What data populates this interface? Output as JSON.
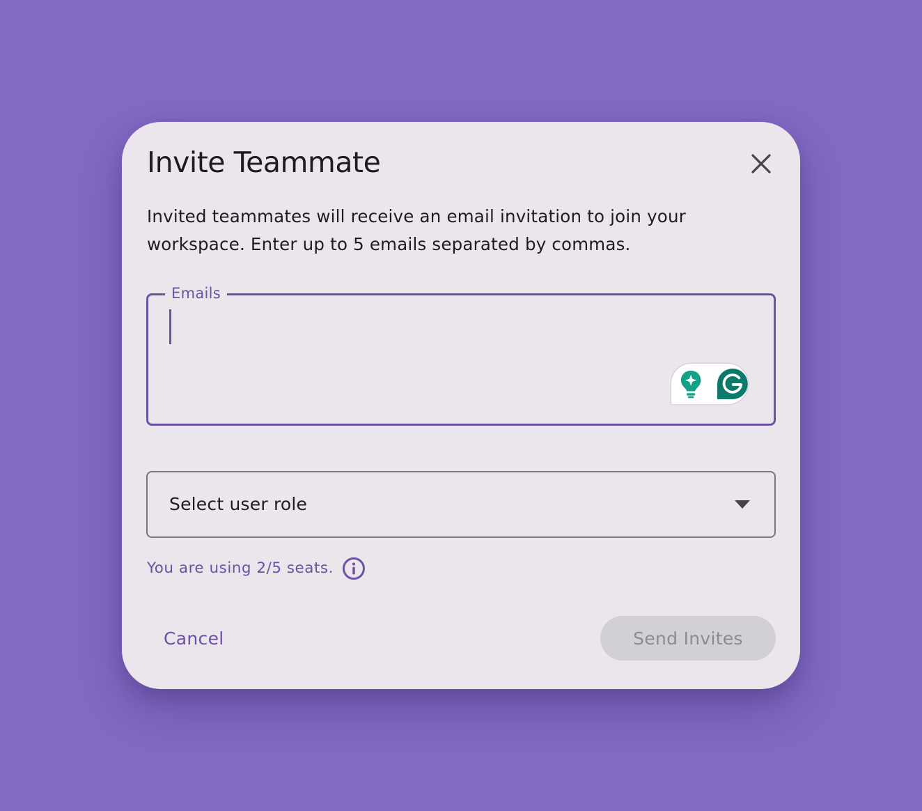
{
  "dialog": {
    "title": "Invite Teammate",
    "description": "Invited teammates will receive an email invitation to join your workspace. Enter up to 5 emails separated by commas.",
    "close_icon": "close-icon"
  },
  "emails_field": {
    "label": "Emails",
    "value": ""
  },
  "grammarly": {
    "icons": [
      "lightbulb-sparkle-icon",
      "grammarly-g-icon"
    ]
  },
  "role_select": {
    "placeholder": "Select user role",
    "icon": "dropdown-arrow-icon"
  },
  "seats": {
    "text": "You are using 2/5 seats.",
    "icon": "info-icon"
  },
  "actions": {
    "cancel_label": "Cancel",
    "send_label": "Send Invites"
  },
  "colors": {
    "background": "#8169c4",
    "dialog": "#ebe6ec",
    "accent": "#6c51a4",
    "grammarly_green": "#15a08a",
    "disabled_button": "#d3cfd6"
  }
}
